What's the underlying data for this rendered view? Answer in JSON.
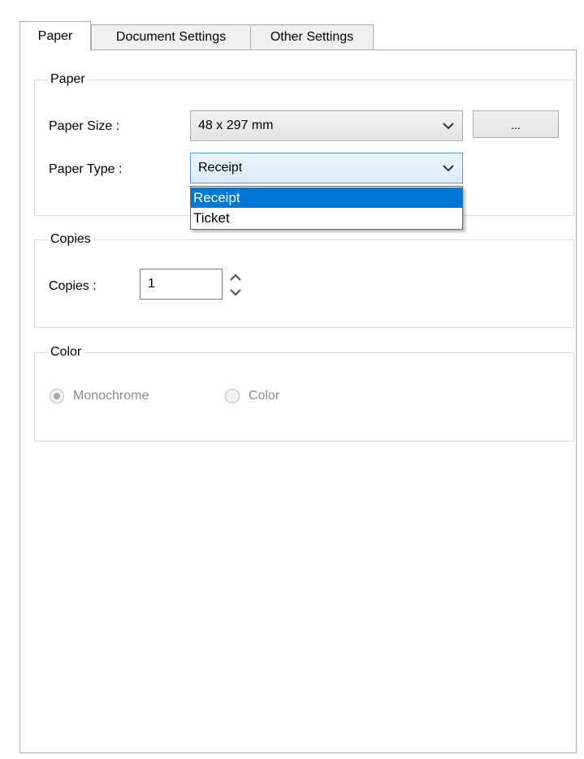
{
  "tabs": [
    {
      "label": "Paper",
      "active": true
    },
    {
      "label": "Document Settings",
      "active": false
    },
    {
      "label": "Other Settings",
      "active": false
    }
  ],
  "paper_group": {
    "title": "Paper",
    "paper_size_label": "Paper Size :",
    "paper_size_value": "48 x 297 mm",
    "ellipsis_button_label": "...",
    "paper_type_label": "Paper Type :",
    "paper_type_value": "Receipt",
    "paper_type_options": [
      "Receipt",
      "Ticket"
    ],
    "paper_type_selected": "Receipt"
  },
  "copies_group": {
    "title": "Copies",
    "copies_label": "Copies :",
    "copies_value": "1"
  },
  "color_group": {
    "title": "Color",
    "options": [
      {
        "label": "Monochrome",
        "checked": true,
        "enabled": false
      },
      {
        "label": "Color",
        "checked": false,
        "enabled": false
      }
    ]
  },
  "colors": {
    "selection": "#0078d7",
    "focus_border": "#569de5",
    "disabled_text": "#8d8d8d"
  },
  "icons": {
    "dropdown_arrow": "chevron-down-icon",
    "spinner": "spinner-arrows-icon"
  }
}
